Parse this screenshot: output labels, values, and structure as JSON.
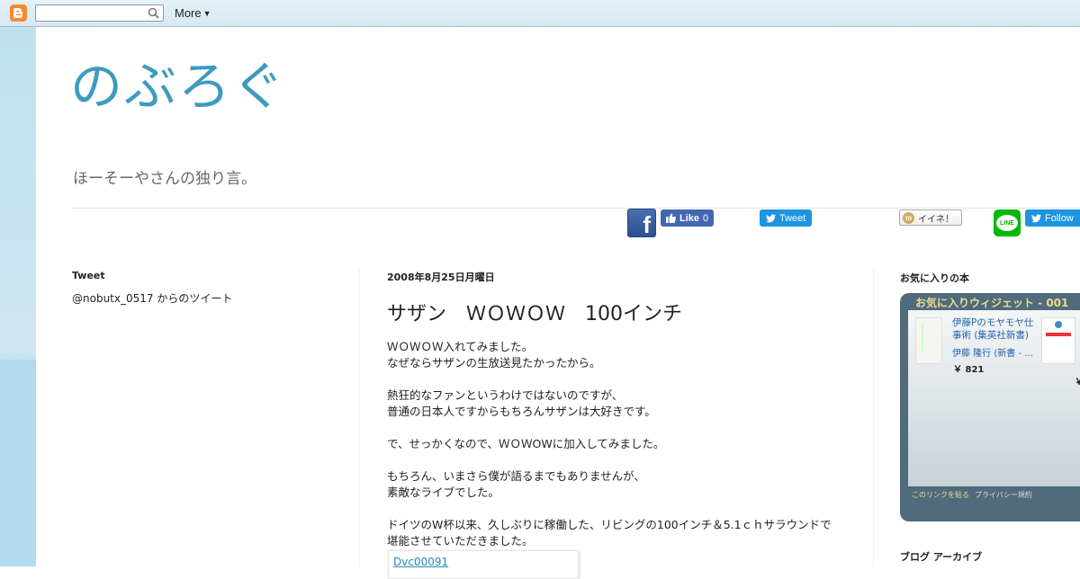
{
  "navbar": {
    "more_label": "More",
    "search": {
      "value": "",
      "placeholder": ""
    }
  },
  "header": {
    "title": "のぶろぐ",
    "description": "ほーそーやさんの独り言。"
  },
  "share": {
    "fb_like_label": "Like",
    "fb_like_count": "0",
    "tweet_label": "Tweet",
    "mixi_label": "イイネ！",
    "line_label": "LINE",
    "follow_label": "Follow"
  },
  "left_sidebar": {
    "heading": "Tweet",
    "tweets_by": "@nobutx_0517 からのツイート"
  },
  "post": {
    "date": "2008年8月25日月曜日",
    "title": "サザン　ＷＯＷＯＷ　100インチ",
    "paragraphs": [
      [
        "ＷＯＷＯＷ入れてみました。",
        "なぜならサザンの生放送見たかったから。"
      ],
      [
        "熱狂的なファンというわけではないのですが、",
        "普通の日本人ですからもちろんサザンは大好きです。"
      ],
      [
        "で、せっかくなので、ＷＯＷOWに加入してみました。"
      ],
      [
        "もちろん、いまさら僕が語るまでもありませんが、",
        "素敵なライブでした。"
      ],
      [
        "ドイツのW杯以来、久しぶりに稼働した、リビングの100インチ＆5.1ｃｈサラウンドで",
        "堪能させていただきました。"
      ]
    ],
    "image_alt": "Dvc00091"
  },
  "right_sidebar": {
    "favorites_heading": "お気に入りの本",
    "widget": {
      "title": "お気に入りウィジェット - 001",
      "book1_title": "伊藤Pのモヤモヤ仕事術 (集英社新書)",
      "book1_author": "伊藤 隆行 (新書 - …",
      "book1_price": "￥ 821",
      "book2_price": "￥",
      "link_paste": "このリンクを貼る",
      "link_privacy": "プライバシー規約"
    },
    "archive_heading": "ブログ アーカイブ"
  },
  "colors": {
    "title_blue": "#3d9bbf",
    "fb_blue": "#4267b2",
    "twitter_blue": "#1b95e0",
    "line_green": "#00b900",
    "blogger_orange": "#f58a32"
  }
}
